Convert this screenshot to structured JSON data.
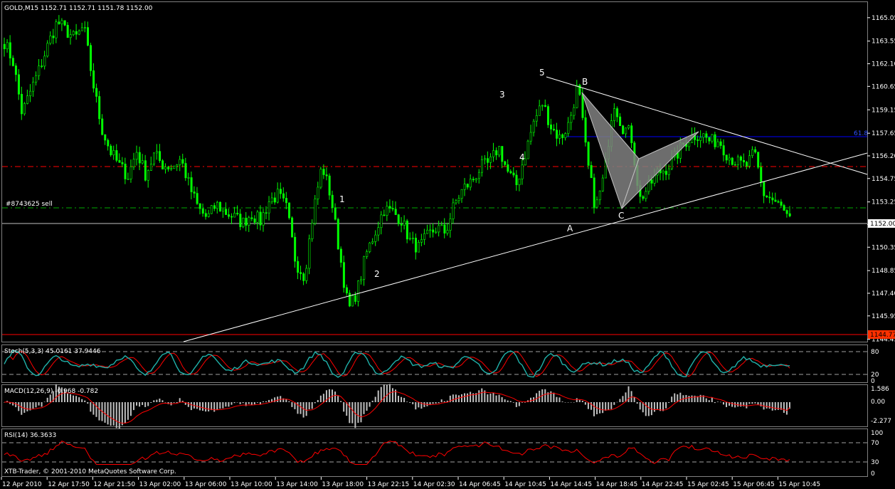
{
  "window": {
    "title": "GOLD,M15  1152.71 1152.71 1151.78 1152.00",
    "copyright": "XTB-Trader, © 2001-2010 MetaQuotes Software Corp."
  },
  "colors": {
    "background": "#000000",
    "bull_candle": "#00ff00",
    "bear_candle": "#00ff00",
    "grid": "#ffffff",
    "signal": "#ff0000",
    "stoch_main": "#20b2aa",
    "fib_line": "#0000ff",
    "pattern_fill": "#808080"
  },
  "chart_data": [
    {
      "type": "candlestick",
      "name": "price",
      "symbol": "GOLD",
      "timeframe": "M15",
      "ylim": [
        1144.3,
        1166.0
      ],
      "yticks": [
        "1165.05",
        "1163.55",
        "1162.10",
        "1160.65",
        "1159.15",
        "1157.65",
        "1156.20",
        "1154.75",
        "1153.25",
        "1151.80",
        "1150.35",
        "1148.85",
        "1147.40",
        "1145.95",
        "1144.45"
      ],
      "xticks": [
        "12 Apr 2010",
        "12 Apr 17:50",
        "12 Apr 21:50",
        "13 Apr 02:00",
        "13 Apr 06:00",
        "13 Apr 10:00",
        "13 Apr 14:00",
        "13 Apr 18:00",
        "13 Apr 22:15",
        "14 Apr 02:30",
        "14 Apr 06:45",
        "14 Apr 10:45",
        "14 Apr 14:45",
        "14 Apr 18:45",
        "14 Apr 22:45",
        "15 Apr 02:45",
        "15 Apr 06:45",
        "15 Apr 10:45"
      ],
      "close_path": [
        1163.5,
        1162.2,
        1158.9,
        1160.4,
        1161.8,
        1163.4,
        1164.8,
        1164.2,
        1163.7,
        1164.5,
        1161.0,
        1158.0,
        1156.5,
        1155.6,
        1154.9,
        1156.5,
        1155.0,
        1156.3,
        1155.6,
        1155.5,
        1156.0,
        1154.2,
        1152.8,
        1152.2,
        1153.1,
        1152.6,
        1152.3,
        1151.9,
        1152.5,
        1152.0,
        1153.3,
        1153.7,
        1152.8,
        1149.4,
        1148.5,
        1152.6,
        1155.6,
        1153.6,
        1149.9,
        1146.3,
        1147.6,
        1149.9,
        1151.3,
        1152.8,
        1152.6,
        1152.1,
        1150.7,
        1150.3,
        1151.1,
        1151.6,
        1151.3,
        1153.1,
        1154.1,
        1154.6,
        1155.5,
        1155.7,
        1156.8,
        1155.2,
        1154.3,
        1156.3,
        1158.4,
        1159.6,
        1158.0,
        1157.3,
        1158.3,
        1160.8,
        1156.0,
        1152.8,
        1155.0,
        1159.8,
        1158.1,
        1157.6,
        1153.4,
        1154.2,
        1155.1,
        1155.4,
        1156.1,
        1157.0,
        1157.5,
        1157.6,
        1157.1,
        1157.2,
        1156.2,
        1155.8,
        1155.5,
        1156.4,
        1153.8,
        1153.4,
        1152.9,
        1152.0
      ],
      "current_price": "1152.00",
      "horizontal_lines": {
        "current": "1152.00",
        "support": "1144.77",
        "fib_label": "61.8",
        "order_label": "#8743625 sell"
      },
      "wave_labels": [
        "1",
        "2",
        "3",
        "4",
        "5"
      ],
      "pattern_labels": [
        "A",
        "B",
        "C"
      ]
    },
    {
      "type": "line",
      "name": "stochastic",
      "header": "Stoch(5,3,3) 45.0161 37.9446",
      "ylim": [
        0,
        100
      ],
      "yticks": [
        "80",
        "20",
        "0"
      ],
      "series": [
        {
          "name": "main",
          "value": 45.0161
        },
        {
          "name": "signal",
          "value": 37.9446
        }
      ]
    },
    {
      "type": "bar",
      "name": "macd",
      "header": "MACD(12,26,9) -0.968 -0.782",
      "yticks": [
        "1.586",
        "0.00",
        "-2.277"
      ],
      "series": [
        {
          "name": "macd",
          "value": -0.968
        },
        {
          "name": "signal",
          "value": -0.782
        }
      ]
    },
    {
      "type": "line",
      "name": "rsi",
      "header": "RSI(14) 36.3633",
      "ylim": [
        0,
        100
      ],
      "yticks": [
        "100",
        "70",
        "30",
        "0"
      ],
      "series": [
        {
          "name": "rsi",
          "value": 36.3633
        }
      ]
    }
  ]
}
